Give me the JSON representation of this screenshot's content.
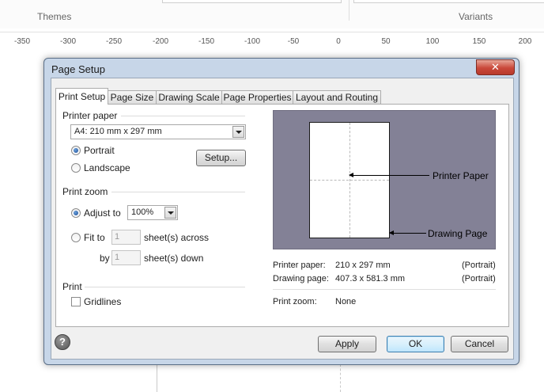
{
  "background": {
    "ribbon_groups": [
      "Themes",
      "Variants"
    ],
    "ruler_ticks": [
      "-350",
      "-300",
      "-250",
      "-200",
      "-150",
      "-100",
      "-50",
      "0",
      "50",
      "100",
      "150",
      "200"
    ]
  },
  "dialog": {
    "title": "Page Setup",
    "close_label": "✕",
    "tabs": [
      "Print Setup",
      "Page Size",
      "Drawing Scale",
      "Page Properties",
      "Layout and Routing"
    ],
    "active_tab": "Print Setup",
    "printer_paper": {
      "header": "Printer paper",
      "selected": "A4:  210 mm x 297 mm",
      "orientation_options": [
        "Portrait",
        "Landscape"
      ],
      "selected_orientation": "Portrait",
      "setup_button": "Setup..."
    },
    "print_zoom": {
      "header": "Print zoom",
      "adjust_to_label": "Adjust to",
      "adjust_to_value": "100%",
      "fit_to_label": "Fit to",
      "fit_across_value": "1",
      "fit_across_label": "sheet(s) across",
      "by_label": "by",
      "fit_down_value": "1",
      "fit_down_label": "sheet(s) down",
      "selected": "Adjust to"
    },
    "print": {
      "header": "Print",
      "gridlines_label": "Gridlines",
      "gridlines_checked": false
    },
    "preview": {
      "printer_paper_callout": "Printer Paper",
      "drawing_page_callout": "Drawing Page",
      "background_color": "#838196"
    },
    "info": {
      "printer_paper_label": "Printer paper:",
      "printer_paper_value": "210 x 297 mm",
      "printer_paper_orientation": "(Portrait)",
      "drawing_page_label": "Drawing page:",
      "drawing_page_value": "407.3 x 581.3 mm",
      "drawing_page_orientation": "(Portrait)",
      "print_zoom_label": "Print zoom:",
      "print_zoom_value": "None"
    },
    "buttons": {
      "help": "?",
      "apply": "Apply",
      "ok": "OK",
      "cancel": "Cancel"
    }
  }
}
